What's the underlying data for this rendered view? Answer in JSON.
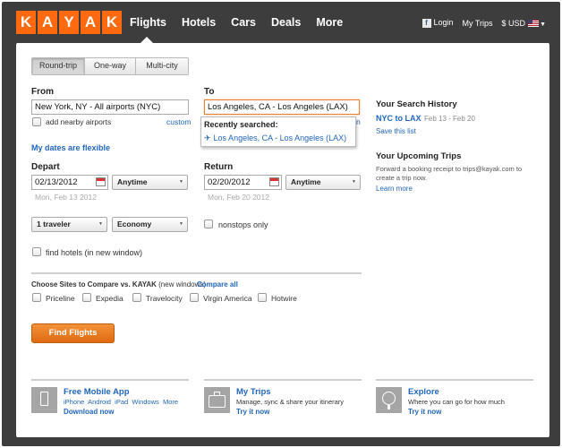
{
  "logo": [
    "K",
    "A",
    "Y",
    "A",
    "K"
  ],
  "nav": [
    "Flights",
    "Hotels",
    "Cars",
    "Deals",
    "More"
  ],
  "header_right": {
    "fb_icon": "f",
    "login": "Login",
    "my_trips": "My Trips",
    "currency": "$ USD"
  },
  "trip_tabs": [
    "Round-trip",
    "One-way",
    "Multi-city"
  ],
  "from": {
    "label": "From",
    "value": "New York, NY - All airports (NYC)",
    "nearby": "add nearby airports",
    "custom": "custom"
  },
  "to": {
    "label": "To",
    "value": "Los Angeles, CA - Los Angeles (LAX)",
    "custom_partial": "n"
  },
  "recent": {
    "heading": "Recently searched:",
    "item": "Los Angeles, CA - Los Angeles (LAX)"
  },
  "flexible": "My dates are flexible",
  "depart": {
    "label": "Depart",
    "date": "02/13/2012",
    "time": "Anytime",
    "hint": "Mon, Feb 13 2012"
  },
  "return": {
    "label": "Return",
    "date": "02/20/2012",
    "time": "Anytime",
    "hint": "Mon, Feb 20 2012"
  },
  "travelers": "1 traveler",
  "cabin": "Economy",
  "nonstop": "nonstops only",
  "find_hotels": "find hotels (in new window)",
  "compare": {
    "title": "Choose Sites to Compare vs. KAYAK",
    "note": "(new windows)",
    "all": "Compare all",
    "sites": [
      "Priceline",
      "Expedia",
      "Travelocity",
      "Virgin America",
      "Hotwire"
    ]
  },
  "find_button": "Find Flights",
  "history": {
    "title": "Your Search History",
    "route": "NYC to LAX",
    "dates": "Feb 13 - Feb 20",
    "save": "Save this list"
  },
  "upcoming": {
    "title": "Your Upcoming Trips",
    "desc": "Forward a booking receipt to trips@kayak.com to create a trip now.",
    "learn": "Learn more"
  },
  "promo_app": {
    "title": "Free Mobile App",
    "platforms": [
      "iPhone",
      "Android",
      "iPad",
      "Windows",
      "More"
    ],
    "link": "Download now"
  },
  "promo_trips": {
    "title": "My Trips",
    "desc": "Manage, sync & share your itinerary",
    "link": "Try it now"
  },
  "promo_explore": {
    "title": "Explore",
    "desc": "Where you can go for how much",
    "link": "Try it now"
  }
}
